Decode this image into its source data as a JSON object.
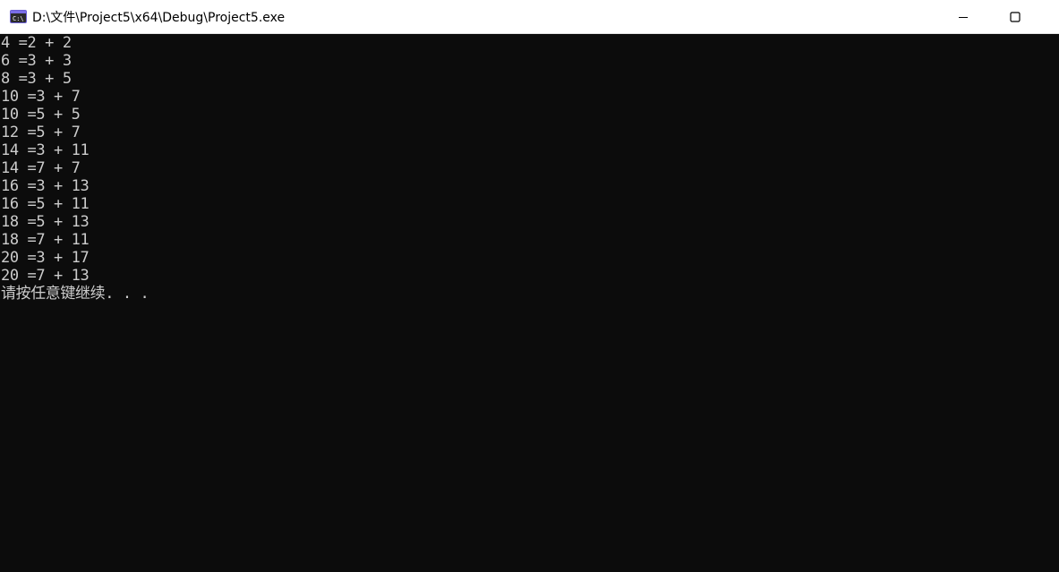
{
  "window": {
    "title": "D:\\文件\\Project5\\x64\\Debug\\Project5.exe",
    "icon": "console-app-icon"
  },
  "controls": {
    "minimize_icon": "minimize-icon",
    "maximize_icon": "maximize-icon"
  },
  "console": {
    "lines": [
      "4 =2 + 2",
      "6 =3 + 3",
      "8 =3 + 5",
      "10 =3 + 7",
      "10 =5 + 5",
      "12 =5 + 7",
      "14 =3 + 11",
      "14 =7 + 7",
      "16 =3 + 13",
      "16 =5 + 11",
      "18 =5 + 13",
      "18 =7 + 11",
      "20 =3 + 17",
      "20 =7 + 13",
      "请按任意键继续. . ."
    ]
  },
  "colors": {
    "console_bg": "#0c0c0c",
    "console_text": "#cccccc",
    "titlebar_bg": "#ffffff"
  }
}
